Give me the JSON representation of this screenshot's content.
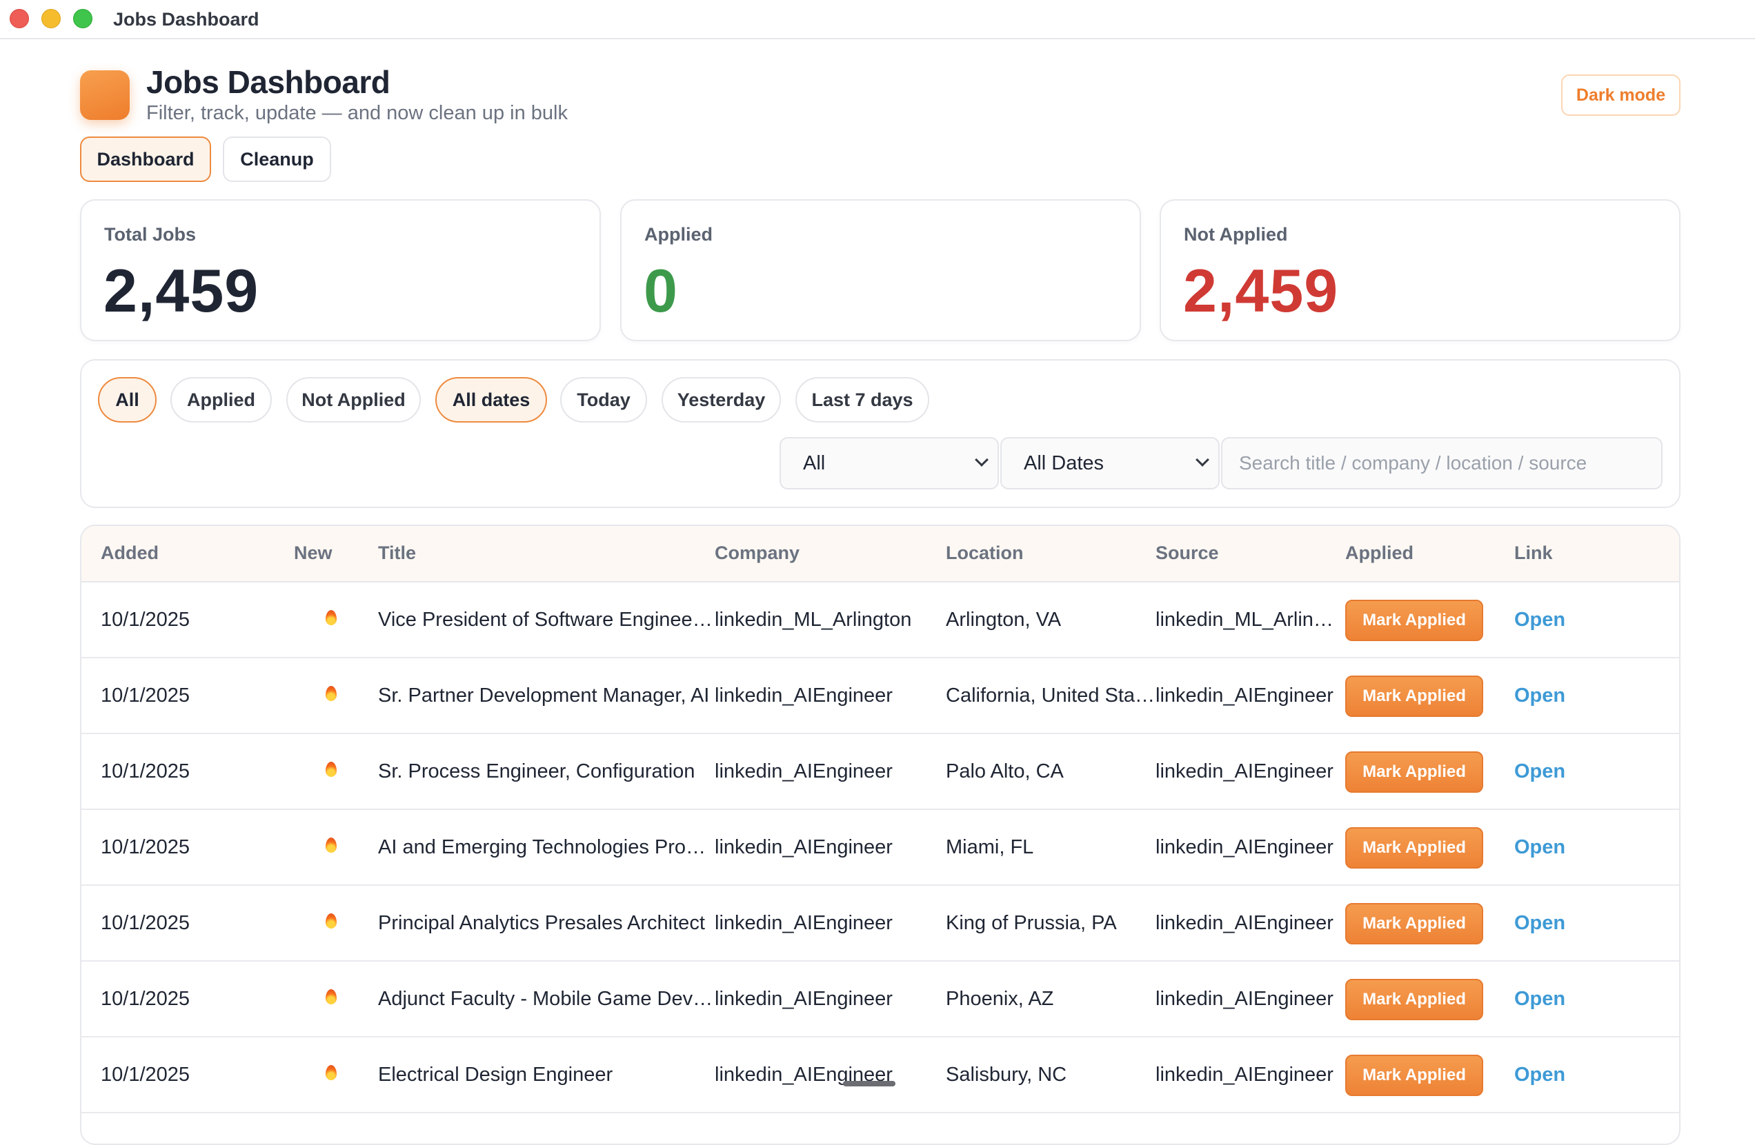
{
  "window": {
    "title": "Jobs Dashboard"
  },
  "header": {
    "title": "Jobs Dashboard",
    "subtitle": "Filter, track, update — and now clean up in bulk",
    "dark_mode_label": "Dark mode",
    "accent_color": "#ee7d2c"
  },
  "tabs": [
    {
      "label": "Dashboard",
      "active": true
    },
    {
      "label": "Cleanup",
      "active": false
    }
  ],
  "stats": [
    {
      "label": "Total Jobs",
      "value": "2,459",
      "color": "#1f2533"
    },
    {
      "label": "Applied",
      "value": "0",
      "color": "#3d9a4b"
    },
    {
      "label": "Not Applied",
      "value": "2,459",
      "color": "#d03a34"
    }
  ],
  "filters": {
    "chips": [
      {
        "label": "All",
        "active": true
      },
      {
        "label": "Applied",
        "active": false
      },
      {
        "label": "Not Applied",
        "active": false
      },
      {
        "label": "All dates",
        "active": true
      },
      {
        "label": "Today",
        "active": false
      },
      {
        "label": "Yesterday",
        "active": false
      },
      {
        "label": "Last 7 days",
        "active": false
      }
    ],
    "status_select": "All",
    "date_select": "All Dates",
    "search_placeholder": "Search title / company / location / source",
    "search_value": ""
  },
  "table": {
    "headers": [
      "Added",
      "New",
      "Title",
      "Company",
      "Location",
      "Source",
      "Applied",
      "Link"
    ],
    "mark_label": "Mark Applied",
    "link_label": "Open",
    "rows": [
      {
        "added": "10/1/2025",
        "new": "flame-icon",
        "title": "Vice President of Software Engineering",
        "company": "linkedin_ML_Arlington",
        "location": "Arlington, VA",
        "source": "linkedin_ML_Arlington"
      },
      {
        "added": "10/1/2025",
        "new": "flame-icon",
        "title": "Sr. Partner Development Manager, AI",
        "company": "linkedin_AIEngineer",
        "location": "California, United States",
        "source": "linkedin_AIEngineer"
      },
      {
        "added": "10/1/2025",
        "new": "flame-icon",
        "title": "Sr. Process Engineer, Configuration",
        "company": "linkedin_AIEngineer",
        "location": "Palo Alto, CA",
        "source": "linkedin_AIEngineer"
      },
      {
        "added": "10/1/2025",
        "new": "flame-icon",
        "title": "AI and Emerging Technologies Program",
        "company": "linkedin_AIEngineer",
        "location": "Miami, FL",
        "source": "linkedin_AIEngineer"
      },
      {
        "added": "10/1/2025",
        "new": "flame-icon",
        "title": "Principal Analytics Presales Architect",
        "company": "linkedin_AIEngineer",
        "location": "King of Prussia, PA",
        "source": "linkedin_AIEngineer"
      },
      {
        "added": "10/1/2025",
        "new": "flame-icon",
        "title": "Adjunct Faculty - Mobile Game Development",
        "company": "linkedin_AIEngineer",
        "location": "Phoenix, AZ",
        "source": "linkedin_AIEngineer"
      },
      {
        "added": "10/1/2025",
        "new": "flame-icon",
        "title": "Electrical Design Engineer",
        "company": "linkedin_AIEngineer",
        "location": "Salisbury, NC",
        "source": "linkedin_AIEngineer"
      }
    ]
  }
}
